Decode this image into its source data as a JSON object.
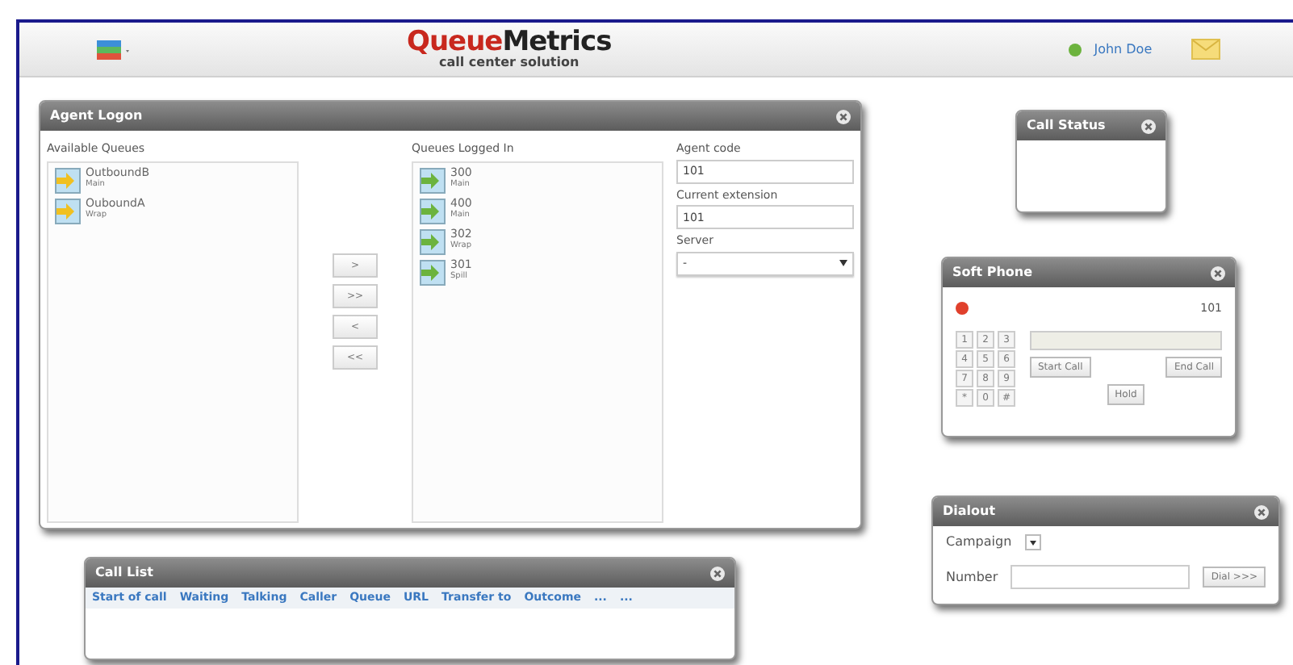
{
  "header": {
    "logo": {
      "part_1": "Queue",
      "part_2": "Metrics",
      "tagline": "call center solution"
    },
    "user": {
      "name": "John Doe",
      "online": true
    }
  },
  "agent_logon": {
    "title": "Agent Logon",
    "available_queues": {
      "label": "Available Queues",
      "items": [
        {
          "name": "OutboundB",
          "sub": "Main"
        },
        {
          "name": "OuboundA",
          "sub": "Wrap"
        }
      ]
    },
    "move_buttons": [
      ">",
      ">>",
      "<",
      "<<"
    ],
    "logged_in_queues": {
      "label": "Queues Logged In",
      "items": [
        {
          "name": "300",
          "sub": "Main"
        },
        {
          "name": "400",
          "sub": "Main"
        },
        {
          "name": "302",
          "sub": "Wrap"
        },
        {
          "name": "301",
          "sub": "Spill"
        }
      ]
    },
    "agent_code": {
      "label": "Agent code",
      "value": "101"
    },
    "current_extension": {
      "label": "Current extension",
      "value": "101"
    },
    "server": {
      "label": "Server",
      "value": "-"
    }
  },
  "call_status": {
    "title": "Call Status"
  },
  "soft_phone": {
    "title": "Soft Phone",
    "registered": false,
    "extension": "101",
    "keys": [
      "1",
      "2",
      "3",
      "4",
      "5",
      "6",
      "7",
      "8",
      "9",
      "*",
      "0",
      "#"
    ],
    "buttons": [
      "Start Call",
      "End Call"
    ],
    "hold_button": "Hold"
  },
  "dialout": {
    "title": "Dialout",
    "campaign_label": "Campaign",
    "number_label": "Number",
    "dial_button": "Dial >>>"
  },
  "call_list": {
    "title": "Call List",
    "columns": [
      "Start of call",
      "Waiting",
      "Talking",
      "Caller",
      "Queue",
      "URL",
      "Transfer to",
      "Outcome",
      "...",
      "..."
    ]
  }
}
